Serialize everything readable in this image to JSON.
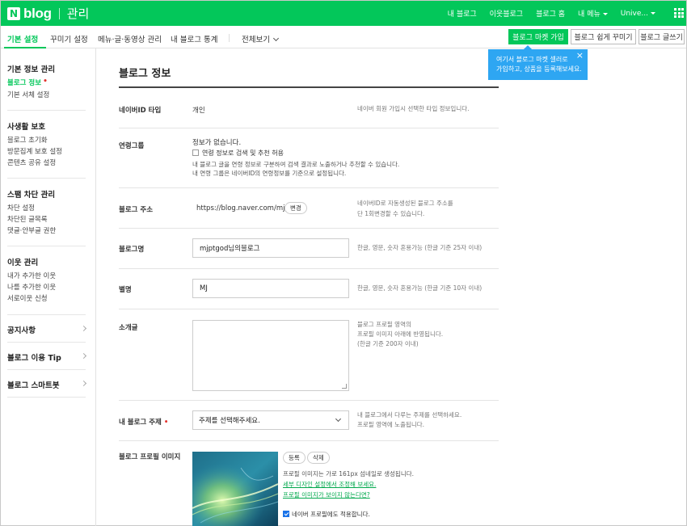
{
  "topbar": {
    "logo_n": "N",
    "logo_text": "blog",
    "admin_text": "관리",
    "links": [
      "내 블로그",
      "이웃블로그",
      "블로그 홈",
      "내 메뉴",
      "Unive..."
    ]
  },
  "tabs": {
    "items": [
      "기본 설정",
      "꾸미기 설정",
      "메뉴·글·동영상 관리",
      "내 블로그 통계",
      "전체보기"
    ],
    "active": "기본 설정"
  },
  "header_buttons": {
    "market": "블로그 마켓 가입",
    "decorate": "블로그 쉽게 꾸미기",
    "write": "블로그 글쓰기"
  },
  "tooltip": {
    "line1": "여기서 블로그 마켓 셀러로",
    "line2": "가입하고, 상품을 등록해보세요.",
    "close": "×"
  },
  "sidebar": {
    "sections": [
      {
        "title": "기본 정보 관리",
        "items": [
          "블로그 정보",
          "기본 서체 설정"
        ]
      },
      {
        "title": "사생활 보호",
        "items": [
          "블로그 초기화",
          "방문집계 보호 설정",
          "콘텐츠 공유 설정"
        ]
      },
      {
        "title": "스팸 차단 관리",
        "items": [
          "차단 설정",
          "차단된 글목록",
          "댓글·안부글 권한"
        ]
      },
      {
        "title": "이웃 관리",
        "items": [
          "내가 추가한 이웃",
          "나를 추가한 이웃",
          "서로이웃 신청"
        ]
      }
    ],
    "links": [
      "공지사항",
      "블로그 이용 Tip",
      "블로그 스마트봇"
    ]
  },
  "main": {
    "title": "블로그 정보",
    "id_type": {
      "label": "네이버ID 타입",
      "value": "개인",
      "hint": "네이버 회원 가입시 선택한 타입 정보입니다."
    },
    "group": {
      "label": "연령그룹",
      "value": "정보가 없습니다.",
      "checkbox_label": "연령 정보로 검색 및 추천 허용",
      "desc1": "내 블로그 글을 연령 정보로 구분하여 검색 결과로 노출하거나 추천할 수 있습니다.",
      "desc2": "내 연령 그룹은 네이버ID의 연령정보를 기준으로 설정됩니다."
    },
    "address": {
      "label": "블로그 주소",
      "value": "https://blog.naver.com/mjptgod",
      "button": "변경",
      "hint1": "네이버ID로 자동생성된 블로그 주소를",
      "hint2": "단 1회변경할 수 있습니다."
    },
    "blog_name": {
      "label": "블로그명",
      "value": "mjptgod님의블로그",
      "hint": "한글, 영문, 숫자 혼용가능 (한글 기준 25자 이내)"
    },
    "nickname": {
      "label": "별명",
      "value": "MJ",
      "hint": "한글, 영문, 숫자 혼용가능 (한글 기준 10자 이내)"
    },
    "intro": {
      "label": "소개글",
      "value": "",
      "hint1": "블로그 프로필 영역의",
      "hint2": "프로필 이미지 아래에 반영됩니다.",
      "hint3": "(한글 기준 200자 이내)"
    },
    "topic": {
      "label": "내 블로그 주제",
      "required": "•",
      "selected": "주제를 선택해주세요.",
      "hint1": "내 블로그에서 다루는 주제를 선택하세요.",
      "hint2": "프로필 영역에 노출됩니다."
    },
    "profile": {
      "label": "블로그 프로필 이미지",
      "register": "등록",
      "delete": "삭제",
      "desc": "프로필 이미지는 가로 161px 섬네일로 생성됩니다.",
      "link1": "세부 디자인 설정에서 조정해 보세요.",
      "link2": "프로필 이미지가 보이지 않는다면?",
      "checkbox_label": "네이버 프로필에도 적용합니다."
    }
  }
}
